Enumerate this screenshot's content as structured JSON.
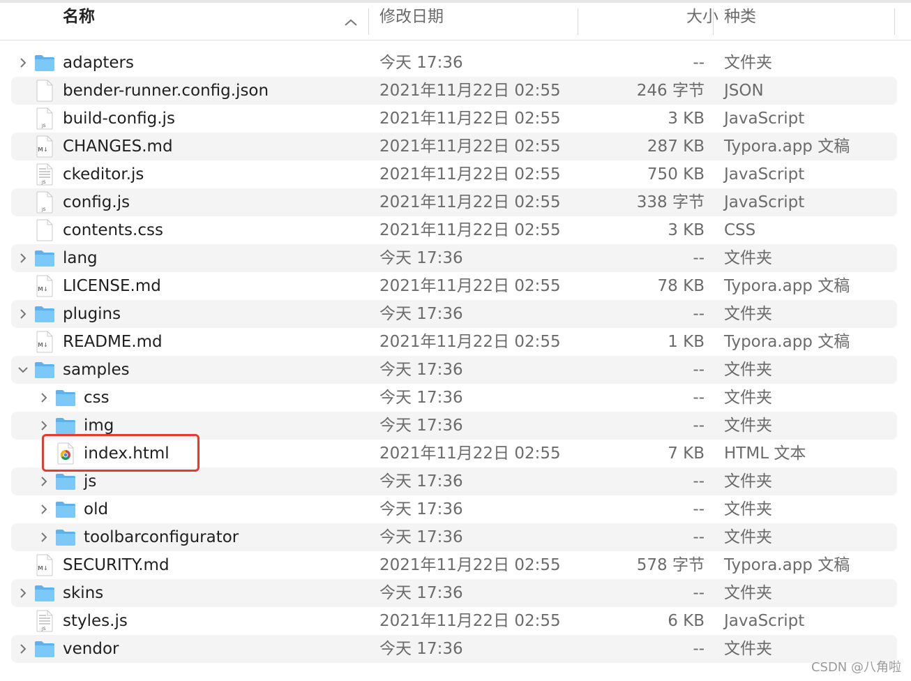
{
  "columns": {
    "name": "名称",
    "date": "修改日期",
    "size": "大小",
    "kind": "种类"
  },
  "rows": [
    {
      "name": "adapters",
      "date": "今天 17:36",
      "size": "--",
      "kind": "文件夹",
      "type": "folder",
      "level": 0,
      "expanded": false
    },
    {
      "name": "bender-runner.config.json",
      "date": "2021年11月22日 02:55",
      "size": "246 字节",
      "kind": "JSON",
      "type": "blank",
      "level": 0
    },
    {
      "name": "build-config.js",
      "date": "2021年11月22日 02:55",
      "size": "3 KB",
      "kind": "JavaScript",
      "type": "js",
      "level": 0
    },
    {
      "name": "CHANGES.md",
      "date": "2021年11月22日 02:55",
      "size": "287 KB",
      "kind": "Typora.app 文稿",
      "type": "md",
      "level": 0
    },
    {
      "name": "ckeditor.js",
      "date": "2021年11月22日 02:55",
      "size": "750 KB",
      "kind": "JavaScript",
      "type": "jslines",
      "level": 0
    },
    {
      "name": "config.js",
      "date": "2021年11月22日 02:55",
      "size": "338 字节",
      "kind": "JavaScript",
      "type": "js",
      "level": 0
    },
    {
      "name": "contents.css",
      "date": "2021年11月22日 02:55",
      "size": "3 KB",
      "kind": "CSS",
      "type": "blank",
      "level": 0
    },
    {
      "name": "lang",
      "date": "今天 17:36",
      "size": "--",
      "kind": "文件夹",
      "type": "folder",
      "level": 0,
      "expanded": false
    },
    {
      "name": "LICENSE.md",
      "date": "2021年11月22日 02:55",
      "size": "78 KB",
      "kind": "Typora.app 文稿",
      "type": "md",
      "level": 0
    },
    {
      "name": "plugins",
      "date": "今天 17:36",
      "size": "--",
      "kind": "文件夹",
      "type": "folder",
      "level": 0,
      "expanded": false
    },
    {
      "name": "README.md",
      "date": "2021年11月22日 02:55",
      "size": "1 KB",
      "kind": "Typora.app 文稿",
      "type": "md",
      "level": 0
    },
    {
      "name": "samples",
      "date": "今天 17:36",
      "size": "--",
      "kind": "文件夹",
      "type": "folder",
      "level": 0,
      "expanded": true
    },
    {
      "name": "css",
      "date": "今天 17:36",
      "size": "--",
      "kind": "文件夹",
      "type": "folder",
      "level": 1,
      "expanded": false
    },
    {
      "name": "img",
      "date": "今天 17:36",
      "size": "--",
      "kind": "文件夹",
      "type": "folder",
      "level": 1,
      "expanded": false
    },
    {
      "name": "index.html",
      "date": "2021年11月22日 02:55",
      "size": "7 KB",
      "kind": "HTML 文本",
      "type": "html",
      "level": 1
    },
    {
      "name": "js",
      "date": "今天 17:36",
      "size": "--",
      "kind": "文件夹",
      "type": "folder",
      "level": 1,
      "expanded": false
    },
    {
      "name": "old",
      "date": "今天 17:36",
      "size": "--",
      "kind": "文件夹",
      "type": "folder",
      "level": 1,
      "expanded": false
    },
    {
      "name": "toolbarconfigurator",
      "date": "今天 17:36",
      "size": "--",
      "kind": "文件夹",
      "type": "folder",
      "level": 1,
      "expanded": false
    },
    {
      "name": "SECURITY.md",
      "date": "2021年11月22日 02:55",
      "size": "578 字节",
      "kind": "Typora.app 文稿",
      "type": "md",
      "level": 0
    },
    {
      "name": "skins",
      "date": "今天 17:36",
      "size": "--",
      "kind": "文件夹",
      "type": "folder",
      "level": 0,
      "expanded": false
    },
    {
      "name": "styles.js",
      "date": "2021年11月22日 02:55",
      "size": "6 KB",
      "kind": "JavaScript",
      "type": "jslines",
      "level": 0
    },
    {
      "name": "vendor",
      "date": "今天 17:36",
      "size": "--",
      "kind": "文件夹",
      "type": "folder",
      "level": 0,
      "expanded": false
    }
  ],
  "highlight_color": "#e53b2c",
  "folder_color": "#5bb2ef",
  "watermark": "CSDN @八角啦"
}
